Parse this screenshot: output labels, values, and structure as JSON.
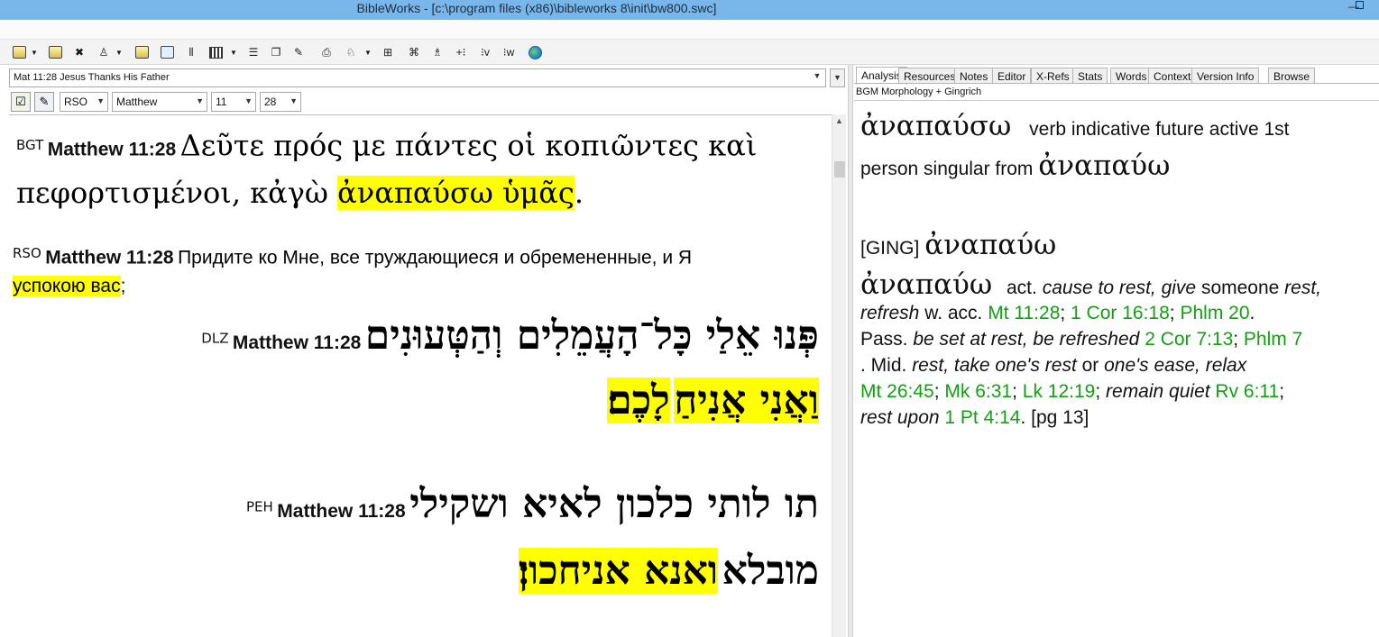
{
  "window": {
    "title": "BibleWorks - [c:\\program files (x86)\\bibleworks 8\\init\\bw800.swc]",
    "minimize_glyph": "—"
  },
  "toolbar": {
    "icons": [
      "search-icon",
      "bookmark-icon",
      "tools-icon",
      "user-icon",
      "highlight-icon",
      "window-icon",
      "parallel-icon",
      "layout-icon",
      "list-icon",
      "copy-icon",
      "edit-icon",
      "print-icon",
      "lexicon-icon",
      "grid-icon",
      "diagram-icon",
      "person-icon",
      "plus-icon",
      "verse-icon",
      "word-icon",
      "globe-icon"
    ]
  },
  "left_pane": {
    "verse_selector": "Mat 11:28 Jesus Thanks His Father",
    "version_select": "RSO",
    "book_select": "Matthew",
    "chapter_select": "11",
    "verse_select": "28",
    "verses": {
      "bgt": {
        "version": "BGT",
        "reference": "Matthew 11:28",
        "text_1": "Δεῦτε πρός με πάντες οἱ κοπιῶντες καὶ",
        "text_2": "πεφορτισμένοι, κἀγὼ ",
        "highlight": "ἀναπαύσω ὑμᾶς",
        "end": "."
      },
      "rso": {
        "version": "RSO",
        "reference": "Matthew 11:28",
        "text": "Придите ко Мне, все труждающиеся и обремененные, и Я",
        "highlight": "успокою вас",
        "end": ";"
      },
      "dlz": {
        "version": "DLZ",
        "reference": "Matthew 11:28",
        "text_1": "פְּנוּ אֵלַי כָּל־הָעֲמֵלִים וְהַטְּעוּנִים",
        "highlight_1": "וַאֲנִי אֲנִיחַ",
        "highlight_2": "לָכֶם׃"
      },
      "peh": {
        "version": "PEH",
        "reference": "Matthew 11:28",
        "text_1": "תו לותי כלכון לאיא ושקילי",
        "text_2": "מובלא",
        "highlight": "ואנא אניחכון׃"
      }
    }
  },
  "right_pane": {
    "tabs": [
      "Analysis",
      "Resources",
      "Notes",
      "Editor",
      "X-Refs",
      "Stats",
      "Words",
      "Context",
      "Version Info",
      "Browse"
    ],
    "active_tab": "Analysis",
    "module": "BGM Morphology + Gingrich",
    "analysis": {
      "headword": "ἀναπαύσω",
      "parse_1": "verb indicative future active 1st",
      "parse_2": "person singular from ",
      "lemma": "ἀναπαύω",
      "ging_label": "[GING] ",
      "ging_lemma": "ἀναπαύω",
      "entry_lemma": "ἀναπαύω",
      "act": "act. ",
      "d1": "cause to rest, give",
      "d1b": " someone ",
      "d1c": "rest,",
      "d2": "refresh",
      "d2b": " w. acc. ",
      "r1": "Mt 11:28",
      "r2": "1 Cor 16:18",
      "r3": "Phlm 20",
      "pass": "Pass. ",
      "d3": "be set at rest, be refreshed",
      "r4": "2 Cor 7:13",
      "r5": "Phlm 7",
      "mid": ". Mid. ",
      "d4": "rest, take one's rest",
      "or": " or ",
      "d5": "one's ease, relax",
      "r6": "Mt 26:45",
      "r7": "Mk 6:31",
      "r8": "Lk 12:19",
      "d6": "remain quiet",
      "r9": "Rv 6:11",
      "d7": "rest upon",
      "r10": "1 Pt 4:14",
      "pg": ". [pg 13]"
    },
    "link_color": "#12a012"
  },
  "highlight_color": "#ffff00"
}
